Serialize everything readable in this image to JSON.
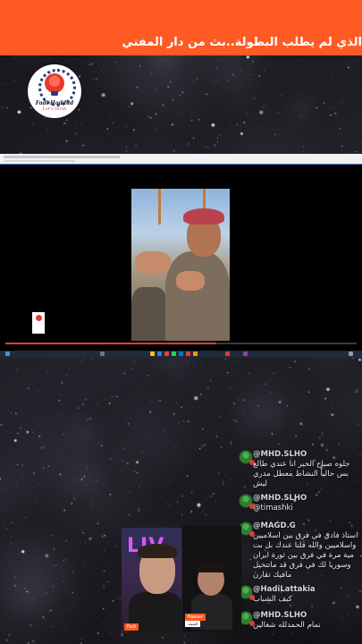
{
  "ticker": {
    "text": "الذي لم يطلب البطولة..بث من دار المفتي"
  },
  "logo": {
    "name": "Fadi Haddad",
    "tagline": "Let's think"
  },
  "shared_screen": {
    "progress": 0.6
  },
  "chat": {
    "messages": [
      {
        "user": "@MHD.SLHO",
        "text": "جلوه صباح الخير انا عندي طالع بس حالياً النشاط معطل مدري ليش"
      },
      {
        "user": "@MHD.SLHO",
        "text": "@timashki"
      },
      {
        "user": "@MAGD.G",
        "text": "استاذ فادي في فرق بين اسلاميين واسلاميين والله قلنا عندك بل بت مية مرة في فرق بين ثورة ايران وسوريا لك في فرق قد ماتتخيل مافيك تقارن"
      },
      {
        "user": "@HadiLattakia",
        "text": "كيف الشباب"
      },
      {
        "user": "@MHD.SLHO",
        "text": "تمام الحمدلله شغالين"
      }
    ]
  },
  "webcams": {
    "host_label": "Fadi",
    "guest_label": "Nasser",
    "guest_sub": "الضيف"
  },
  "colors": {
    "banner": "#ff5a23",
    "chat_avatar": "#2e7d32"
  }
}
